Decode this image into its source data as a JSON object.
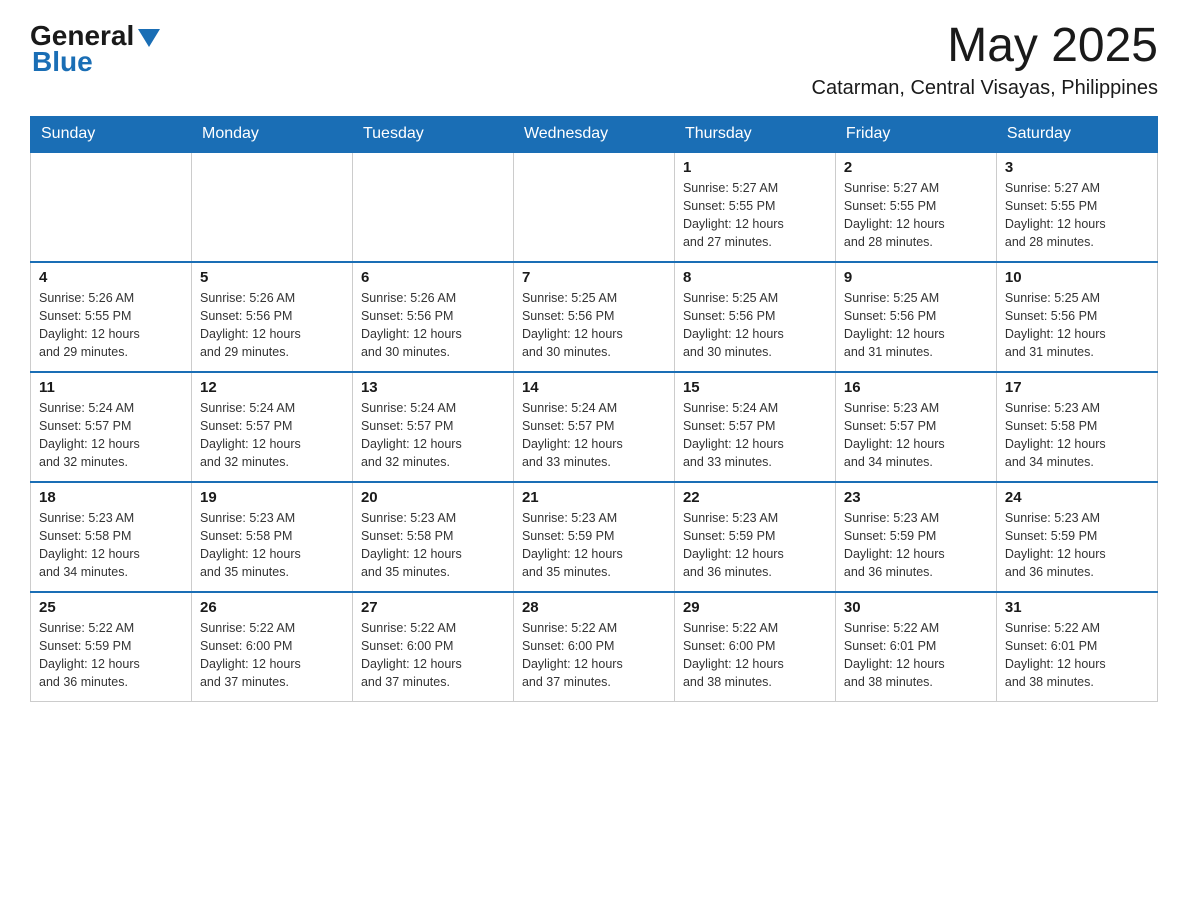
{
  "header": {
    "logo_general": "General",
    "logo_blue": "Blue",
    "month_year": "May 2025",
    "location": "Catarman, Central Visayas, Philippines"
  },
  "days_of_week": [
    "Sunday",
    "Monday",
    "Tuesday",
    "Wednesday",
    "Thursday",
    "Friday",
    "Saturday"
  ],
  "weeks": [
    [
      {
        "day": "",
        "info": ""
      },
      {
        "day": "",
        "info": ""
      },
      {
        "day": "",
        "info": ""
      },
      {
        "day": "",
        "info": ""
      },
      {
        "day": "1",
        "info": "Sunrise: 5:27 AM\nSunset: 5:55 PM\nDaylight: 12 hours\nand 27 minutes."
      },
      {
        "day": "2",
        "info": "Sunrise: 5:27 AM\nSunset: 5:55 PM\nDaylight: 12 hours\nand 28 minutes."
      },
      {
        "day": "3",
        "info": "Sunrise: 5:27 AM\nSunset: 5:55 PM\nDaylight: 12 hours\nand 28 minutes."
      }
    ],
    [
      {
        "day": "4",
        "info": "Sunrise: 5:26 AM\nSunset: 5:55 PM\nDaylight: 12 hours\nand 29 minutes."
      },
      {
        "day": "5",
        "info": "Sunrise: 5:26 AM\nSunset: 5:56 PM\nDaylight: 12 hours\nand 29 minutes."
      },
      {
        "day": "6",
        "info": "Sunrise: 5:26 AM\nSunset: 5:56 PM\nDaylight: 12 hours\nand 30 minutes."
      },
      {
        "day": "7",
        "info": "Sunrise: 5:25 AM\nSunset: 5:56 PM\nDaylight: 12 hours\nand 30 minutes."
      },
      {
        "day": "8",
        "info": "Sunrise: 5:25 AM\nSunset: 5:56 PM\nDaylight: 12 hours\nand 30 minutes."
      },
      {
        "day": "9",
        "info": "Sunrise: 5:25 AM\nSunset: 5:56 PM\nDaylight: 12 hours\nand 31 minutes."
      },
      {
        "day": "10",
        "info": "Sunrise: 5:25 AM\nSunset: 5:56 PM\nDaylight: 12 hours\nand 31 minutes."
      }
    ],
    [
      {
        "day": "11",
        "info": "Sunrise: 5:24 AM\nSunset: 5:57 PM\nDaylight: 12 hours\nand 32 minutes."
      },
      {
        "day": "12",
        "info": "Sunrise: 5:24 AM\nSunset: 5:57 PM\nDaylight: 12 hours\nand 32 minutes."
      },
      {
        "day": "13",
        "info": "Sunrise: 5:24 AM\nSunset: 5:57 PM\nDaylight: 12 hours\nand 32 minutes."
      },
      {
        "day": "14",
        "info": "Sunrise: 5:24 AM\nSunset: 5:57 PM\nDaylight: 12 hours\nand 33 minutes."
      },
      {
        "day": "15",
        "info": "Sunrise: 5:24 AM\nSunset: 5:57 PM\nDaylight: 12 hours\nand 33 minutes."
      },
      {
        "day": "16",
        "info": "Sunrise: 5:23 AM\nSunset: 5:57 PM\nDaylight: 12 hours\nand 34 minutes."
      },
      {
        "day": "17",
        "info": "Sunrise: 5:23 AM\nSunset: 5:58 PM\nDaylight: 12 hours\nand 34 minutes."
      }
    ],
    [
      {
        "day": "18",
        "info": "Sunrise: 5:23 AM\nSunset: 5:58 PM\nDaylight: 12 hours\nand 34 minutes."
      },
      {
        "day": "19",
        "info": "Sunrise: 5:23 AM\nSunset: 5:58 PM\nDaylight: 12 hours\nand 35 minutes."
      },
      {
        "day": "20",
        "info": "Sunrise: 5:23 AM\nSunset: 5:58 PM\nDaylight: 12 hours\nand 35 minutes."
      },
      {
        "day": "21",
        "info": "Sunrise: 5:23 AM\nSunset: 5:59 PM\nDaylight: 12 hours\nand 35 minutes."
      },
      {
        "day": "22",
        "info": "Sunrise: 5:23 AM\nSunset: 5:59 PM\nDaylight: 12 hours\nand 36 minutes."
      },
      {
        "day": "23",
        "info": "Sunrise: 5:23 AM\nSunset: 5:59 PM\nDaylight: 12 hours\nand 36 minutes."
      },
      {
        "day": "24",
        "info": "Sunrise: 5:23 AM\nSunset: 5:59 PM\nDaylight: 12 hours\nand 36 minutes."
      }
    ],
    [
      {
        "day": "25",
        "info": "Sunrise: 5:22 AM\nSunset: 5:59 PM\nDaylight: 12 hours\nand 36 minutes."
      },
      {
        "day": "26",
        "info": "Sunrise: 5:22 AM\nSunset: 6:00 PM\nDaylight: 12 hours\nand 37 minutes."
      },
      {
        "day": "27",
        "info": "Sunrise: 5:22 AM\nSunset: 6:00 PM\nDaylight: 12 hours\nand 37 minutes."
      },
      {
        "day": "28",
        "info": "Sunrise: 5:22 AM\nSunset: 6:00 PM\nDaylight: 12 hours\nand 37 minutes."
      },
      {
        "day": "29",
        "info": "Sunrise: 5:22 AM\nSunset: 6:00 PM\nDaylight: 12 hours\nand 38 minutes."
      },
      {
        "day": "30",
        "info": "Sunrise: 5:22 AM\nSunset: 6:01 PM\nDaylight: 12 hours\nand 38 minutes."
      },
      {
        "day": "31",
        "info": "Sunrise: 5:22 AM\nSunset: 6:01 PM\nDaylight: 12 hours\nand 38 minutes."
      }
    ]
  ]
}
